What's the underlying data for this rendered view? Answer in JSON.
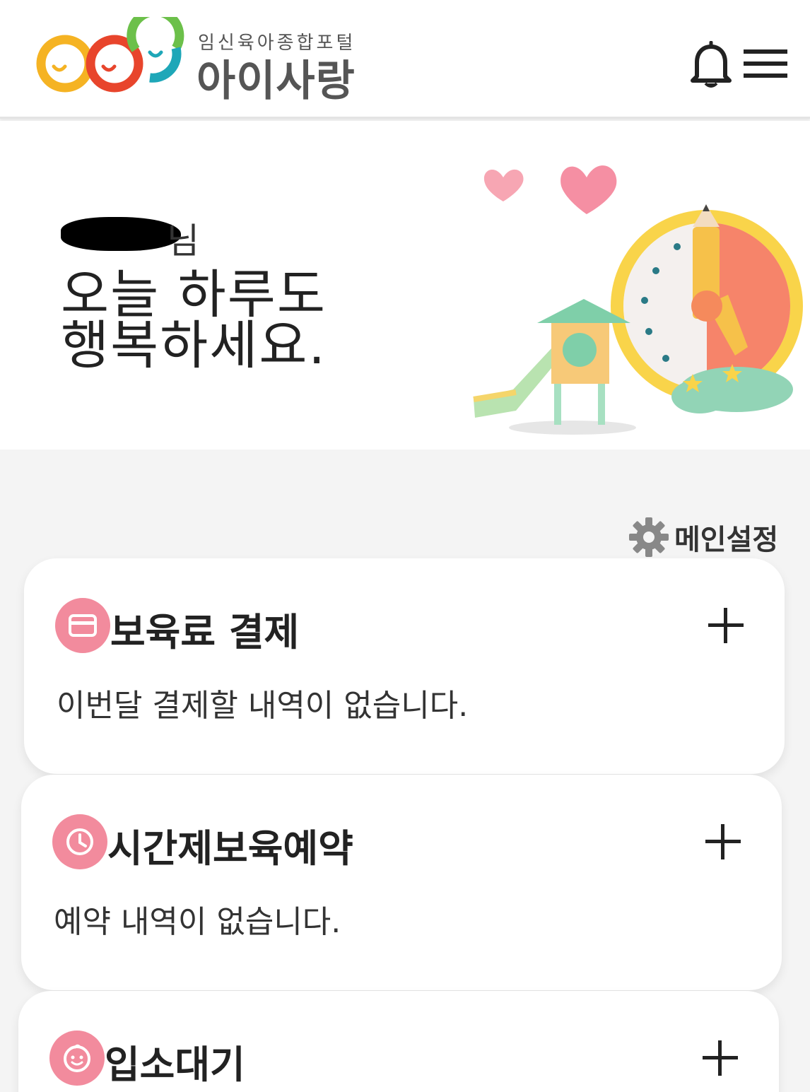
{
  "header": {
    "logo_subtitle": "임신육아종합포털",
    "logo_title": "아이사랑",
    "icons": {
      "notifications": "bell-icon",
      "menu": "hamburger-icon"
    }
  },
  "hero": {
    "greeting_name_suffix": "님",
    "greeting_line1": "오늘 하루도",
    "greeting_line2": "행복하세요."
  },
  "settings": {
    "label": "메인설정",
    "icon": "gear-icon"
  },
  "cards": [
    {
      "title": "보육료 결제",
      "body": "이번달 결제할 내역이 없습니다.",
      "icon": "credit-card-icon"
    },
    {
      "title": "시간제보육예약",
      "body": "예약 내역이 없습니다.",
      "icon": "clock-icon"
    },
    {
      "title": "입소대기",
      "body": "",
      "icon": "baby-face-icon"
    }
  ],
  "colors": {
    "accent_pink": "#f28b9d",
    "logo_orange": "#f5a623",
    "logo_red": "#e8452c",
    "logo_green": "#6cc04a",
    "logo_teal": "#1ea7b8"
  }
}
